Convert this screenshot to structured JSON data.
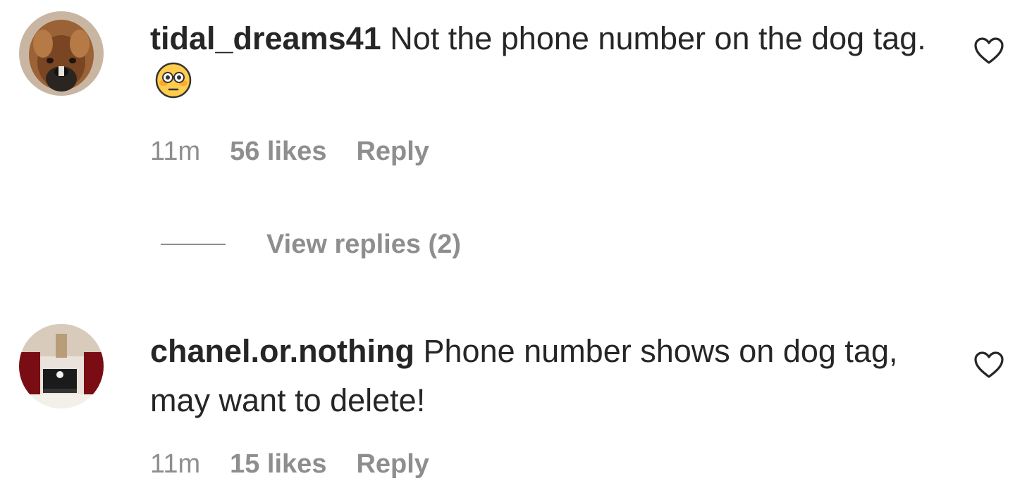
{
  "comments": [
    {
      "username": "tidal_dreams41",
      "text": " Not the phone number on the dog tag.",
      "emoji": "flushed-face-emoji",
      "time": "11m",
      "likes": "56 likes",
      "reply_label": "Reply",
      "view_replies": "View replies (2)"
    },
    {
      "username": "chanel.or.nothing",
      "text": " Phone number shows on dog tag, may want to delete!",
      "time": "11m",
      "likes": "15 likes",
      "reply_label": "Reply"
    }
  ],
  "icons": {
    "like": "heart-outline-icon"
  },
  "colors": {
    "text": "#262626",
    "secondary": "#8e8e8e",
    "background": "#ffffff"
  }
}
